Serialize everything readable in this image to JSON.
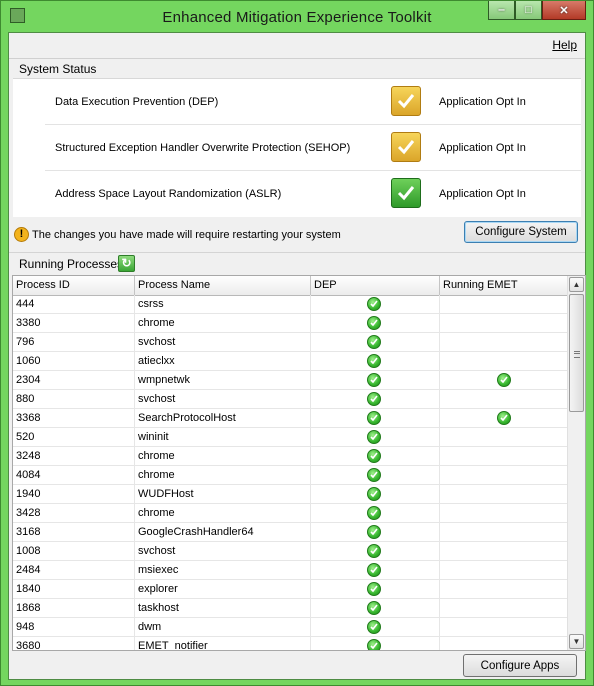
{
  "window": {
    "title": "Enhanced Mitigation Experience Toolkit"
  },
  "menu": {
    "help": "Help"
  },
  "system_status": {
    "header": "System Status",
    "items": [
      {
        "label": "Data Execution Prevention (DEP)",
        "value": "Application Opt In",
        "state": "warning",
        "color": "#e7b631"
      },
      {
        "label": "Structured Exception Handler Overwrite Protection (SEHOP)",
        "value": "Application Opt In",
        "state": "warning",
        "color": "#e7b631"
      },
      {
        "label": "Address Space Layout Randomization (ASLR)",
        "value": "Application Opt In",
        "state": "ok",
        "color": "#3aa635"
      }
    ]
  },
  "notice": {
    "text": "The changes you have made will require restarting your system",
    "icon": "warning-icon"
  },
  "buttons": {
    "configure_system": "Configure System",
    "configure_apps": "Configure Apps"
  },
  "processes": {
    "header": "Running Processes",
    "columns": [
      "Process ID",
      "Process Name",
      "DEP",
      "Running EMET"
    ],
    "rows": [
      {
        "pid": "444",
        "name": "csrss",
        "dep": true,
        "emet": false
      },
      {
        "pid": "3380",
        "name": "chrome",
        "dep": true,
        "emet": false
      },
      {
        "pid": "796",
        "name": "svchost",
        "dep": true,
        "emet": false
      },
      {
        "pid": "1060",
        "name": "atieclxx",
        "dep": true,
        "emet": false
      },
      {
        "pid": "2304",
        "name": "wmpnetwk",
        "dep": true,
        "emet": true
      },
      {
        "pid": "880",
        "name": "svchost",
        "dep": true,
        "emet": false
      },
      {
        "pid": "3368",
        "name": "SearchProtocolHost",
        "dep": true,
        "emet": true
      },
      {
        "pid": "520",
        "name": "wininit",
        "dep": true,
        "emet": false
      },
      {
        "pid": "3248",
        "name": "chrome",
        "dep": true,
        "emet": false
      },
      {
        "pid": "4084",
        "name": "chrome",
        "dep": true,
        "emet": false
      },
      {
        "pid": "1940",
        "name": "WUDFHost",
        "dep": true,
        "emet": false
      },
      {
        "pid": "3428",
        "name": "chrome",
        "dep": true,
        "emet": false
      },
      {
        "pid": "3168",
        "name": "GoogleCrashHandler64",
        "dep": true,
        "emet": false
      },
      {
        "pid": "1008",
        "name": "svchost",
        "dep": true,
        "emet": false
      },
      {
        "pid": "2484",
        "name": "msiexec",
        "dep": true,
        "emet": false
      },
      {
        "pid": "1840",
        "name": "explorer",
        "dep": true,
        "emet": false
      },
      {
        "pid": "1868",
        "name": "taskhost",
        "dep": true,
        "emet": false
      },
      {
        "pid": "948",
        "name": "dwm",
        "dep": true,
        "emet": false
      },
      {
        "pid": "3680",
        "name": "EMET_notifier",
        "dep": true,
        "emet": false
      }
    ]
  }
}
